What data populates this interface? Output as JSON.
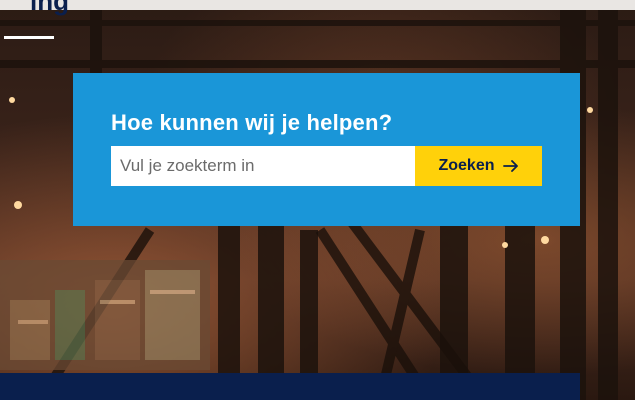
{
  "header": {
    "partial_heading": "ing"
  },
  "search": {
    "title": "Hoe kunnen wij je helpen?",
    "placeholder": "Vul je zoekterm in",
    "value": "",
    "button_label": "Zoeken",
    "button_icon": "arrow-right-icon"
  },
  "colors": {
    "panel": "#1a96d8",
    "button": "#ffd10a",
    "navy": "#0a1f4d"
  }
}
